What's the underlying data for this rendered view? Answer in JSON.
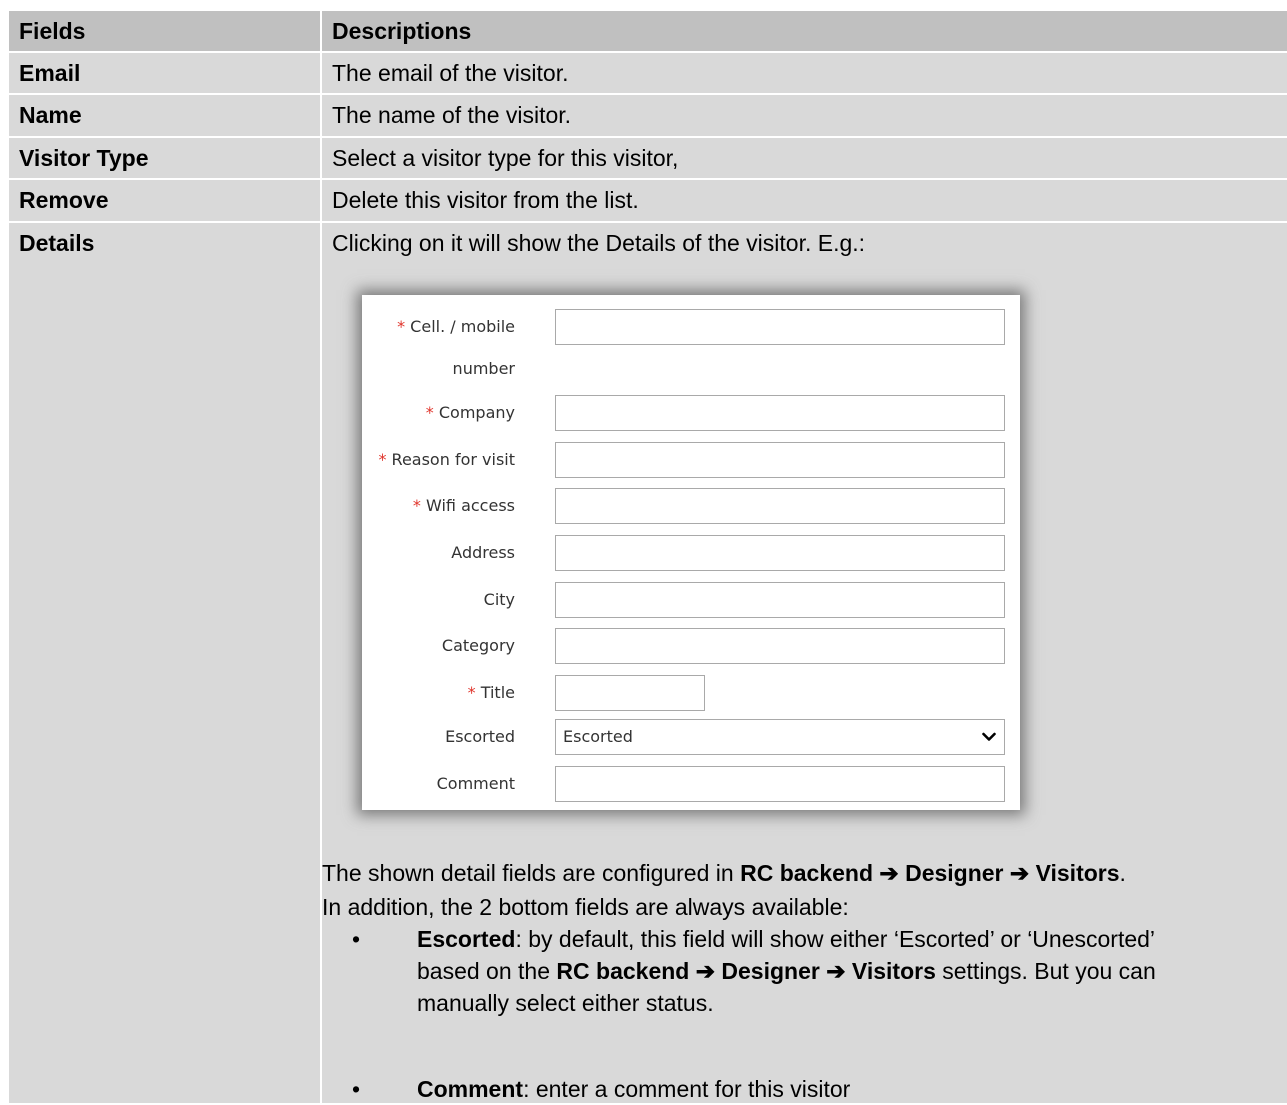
{
  "table": {
    "headers": [
      "Fields",
      "Descriptions"
    ],
    "rows": [
      {
        "field": "Email",
        "description": "The email of the visitor."
      },
      {
        "field": "Name",
        "description": "The name of the visitor."
      },
      {
        "field": "Visitor Type",
        "description": "Select a visitor type for this visitor,"
      },
      {
        "field": "Remove",
        "description": "Delete this visitor from the list."
      },
      {
        "field": "Details",
        "description": "Clicking on it will show the Details of the visitor. E.g.:"
      }
    ]
  },
  "form": {
    "required_mark": "*",
    "fields": [
      {
        "label": "Cell. / mobile",
        "label2": "number",
        "required": true,
        "value": ""
      },
      {
        "label": "Company",
        "required": true,
        "value": ""
      },
      {
        "label": "Reason for visit",
        "required": true,
        "value": ""
      },
      {
        "label": "Wifi access",
        "required": true,
        "value": ""
      },
      {
        "label": "Address",
        "required": false,
        "value": ""
      },
      {
        "label": "City",
        "required": false,
        "value": ""
      },
      {
        "label": "Category",
        "required": false,
        "value": ""
      },
      {
        "label": "Title",
        "required": true,
        "value": ""
      },
      {
        "label": "Escorted",
        "required": false,
        "selected": "Escorted"
      },
      {
        "label": "Comment",
        "required": false,
        "value": ""
      }
    ]
  },
  "details": {
    "intro_pre": "The shown detail fields are configured in ",
    "path": [
      "RC backend",
      "Designer",
      "Visitors"
    ],
    "arrow": "➔",
    "intro_post": ".",
    "line2": "In addition, the 2 bottom fields are always available:",
    "bullets": [
      {
        "term": "Escorted",
        "text1": ": by default, this field will show either ‘Escorted’ or ‘Unescorted’",
        "text2_pre": "based on the ",
        "text2_post": " settings. But you can",
        "text3": "manually select either status."
      },
      {
        "term": "Comment",
        "text1": ": enter a comment for this visitor"
      }
    ],
    "bullet_char": "•"
  }
}
